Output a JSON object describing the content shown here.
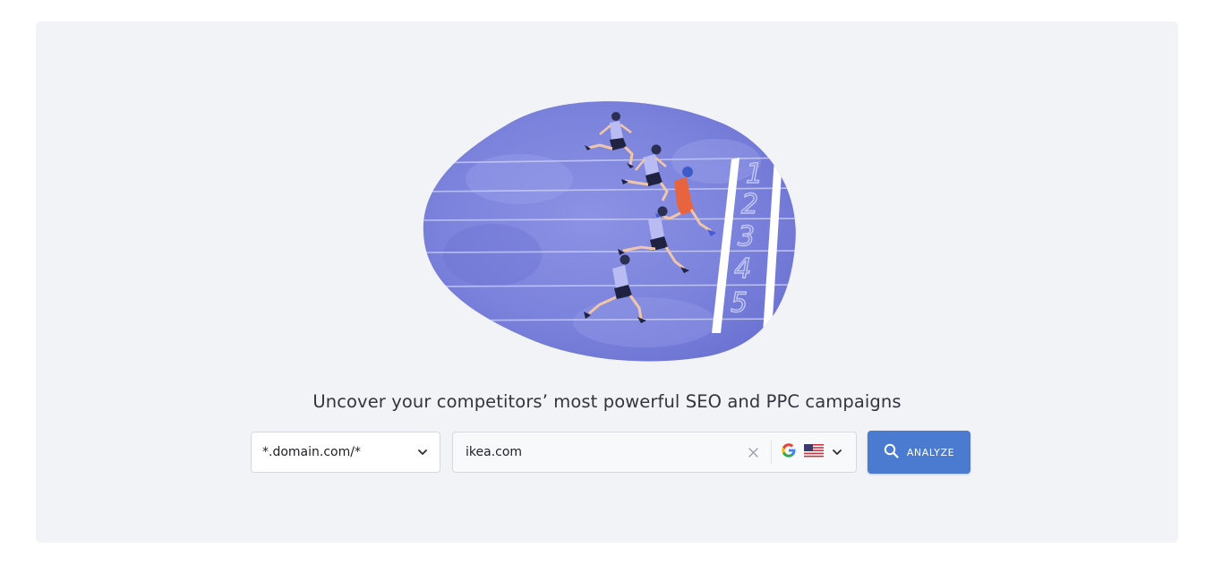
{
  "headline": "Uncover your competitors’ most powerful SEO and PPC campaigns",
  "scope_select": {
    "value": "*.domain.com/*",
    "icon": "chevron-down-icon"
  },
  "search": {
    "value": "ikea.com",
    "clear_icon": "close-icon"
  },
  "engine_select": {
    "engine_icon": "google-icon",
    "flag_icon": "us-flag-icon",
    "chevron_icon": "chevron-down-icon"
  },
  "analyze_button": {
    "label": "ANALYZE",
    "icon": "search-icon",
    "color": "#4a7bd1"
  },
  "illustration": {
    "lane_numbers": [
      "1",
      "2",
      "3",
      "4",
      "5"
    ],
    "blob_color": "#7f87dd"
  }
}
